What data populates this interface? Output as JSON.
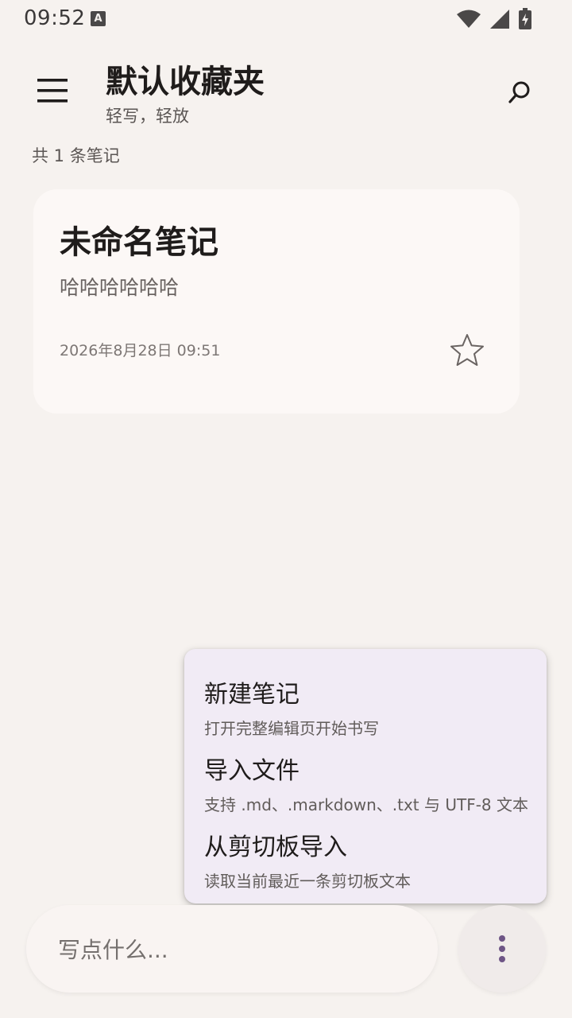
{
  "status_bar": {
    "time": "09:52",
    "input_indicator": "A",
    "icons": [
      "wifi-icon",
      "signal-icon",
      "battery-charging-icon"
    ]
  },
  "header": {
    "title": "默认收藏夹",
    "subtitle": "轻写，轻放",
    "menu_icon": "hamburger-menu-icon",
    "search_icon": "search-icon"
  },
  "notes_summary": {
    "count_text": "共 1 条笔记"
  },
  "notes": [
    {
      "title": "未命名笔记",
      "preview": "哈哈哈哈哈哈",
      "date": "2026年8月28日 09:51",
      "starred": false
    }
  ],
  "popup_menu": {
    "items": [
      {
        "title": "新建笔记",
        "description": "打开完整编辑页开始书写"
      },
      {
        "title": "导入文件",
        "description": "支持 .md、.markdown、.txt 与 UTF-8 文本"
      },
      {
        "title": "从剪切板导入",
        "description": "读取当前最近一条剪切板文本"
      }
    ]
  },
  "compose": {
    "placeholder": "写点什么..."
  },
  "colors": {
    "background": "#f6f2ef",
    "card": "#fcf8f6",
    "popup": "#f1ebf5",
    "accent_dots": "#6e5586"
  }
}
